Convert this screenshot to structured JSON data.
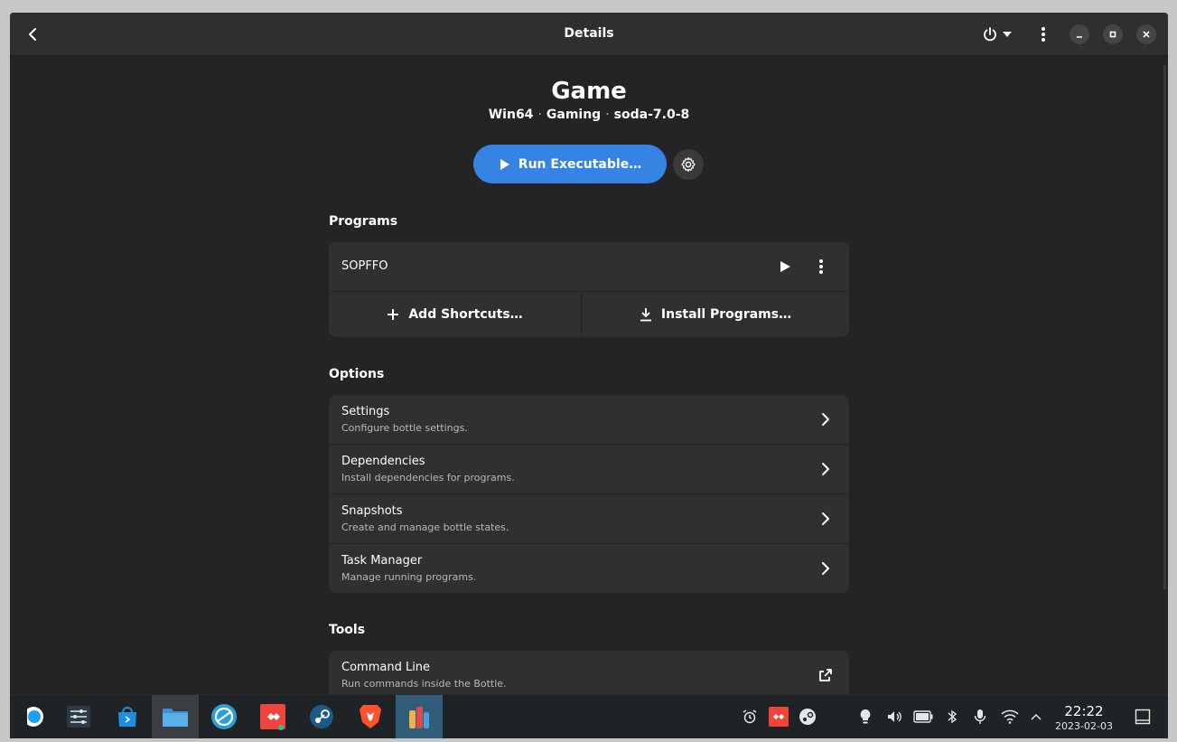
{
  "header": {
    "title": "Details"
  },
  "bottle": {
    "name": "Game",
    "arch": "Win64",
    "environment": "Gaming",
    "runner": "soda-7.0-8",
    "separator": "·"
  },
  "actions": {
    "run_label": "Run Executable…"
  },
  "programs": {
    "section_title": "Programs",
    "items": [
      {
        "name": "SOPFFO"
      }
    ],
    "add_shortcuts_label": "Add Shortcuts…",
    "install_programs_label": "Install Programs…"
  },
  "options": {
    "section_title": "Options",
    "items": [
      {
        "title": "Settings",
        "subtitle": "Configure bottle settings."
      },
      {
        "title": "Dependencies",
        "subtitle": "Install dependencies for programs."
      },
      {
        "title": "Snapshots",
        "subtitle": "Create and manage bottle states."
      },
      {
        "title": "Task Manager",
        "subtitle": "Manage running programs."
      }
    ]
  },
  "tools": {
    "section_title": "Tools",
    "items": [
      {
        "title": "Command Line",
        "subtitle": "Run commands inside the Bottle."
      }
    ]
  },
  "taskbar": {
    "apps": [
      "steam-deck-icon",
      "settings-sliders-icon",
      "store-bag-icon",
      "file-manager-icon",
      "browser-sync-icon",
      "anydesk-icon",
      "steam-icon",
      "brave-icon",
      "bottles-icon"
    ],
    "clock_time": "22:22",
    "clock_date": "2023-02-03"
  },
  "colors": {
    "accent": "#3584e4",
    "window_bg": "#242424",
    "card_bg": "#303030",
    "taskbar_bg": "#202326"
  }
}
